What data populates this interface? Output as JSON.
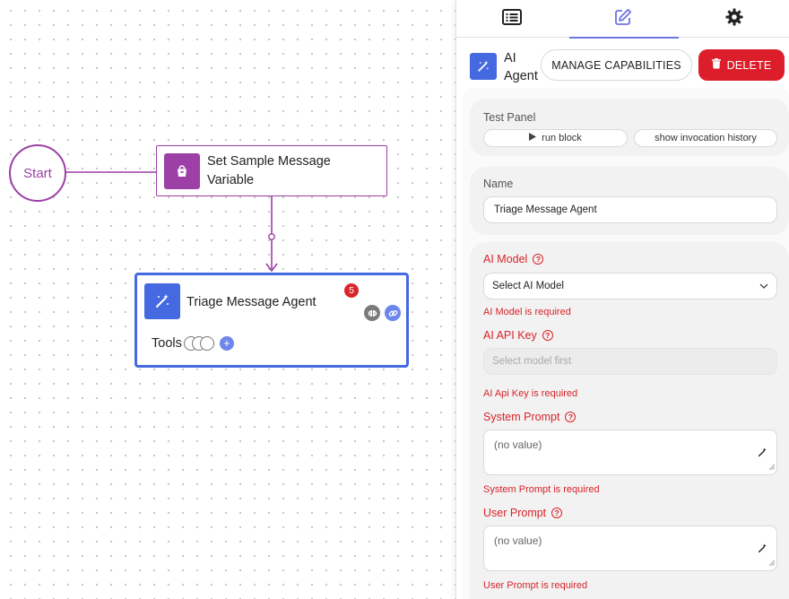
{
  "canvas": {
    "start_label": "Start",
    "set_node": {
      "label": "Set Sample Message Variable",
      "color": "#9c3fa6",
      "icon": "shopping-bag-icon"
    },
    "agent_node": {
      "label": "Triage Message Agent",
      "badge_count": "5",
      "tools_label": "Tools",
      "add_tool": "+",
      "color": "#4569e0",
      "icons": [
        "magic-wand-icon",
        "brain-icon",
        "link-icon"
      ]
    }
  },
  "panel": {
    "tabs": [
      {
        "icon": "list-icon"
      },
      {
        "icon": "edit-icon",
        "active": true
      },
      {
        "icon": "gear-icon"
      }
    ],
    "header": {
      "title": "AI Agent",
      "manage_label": "MANAGE CAPABILITIES",
      "delete_label": "DELETE",
      "delete_color": "#dc1e2a"
    },
    "test_panel": {
      "title": "Test Panel",
      "run_label": "run block",
      "history_label": "show invocation history"
    },
    "name": {
      "label": "Name",
      "value": "Triage Message Agent"
    },
    "fields": {
      "ai_model": {
        "label": "AI Model",
        "help": "?",
        "value": "Select AI Model",
        "error": "AI Model is required"
      },
      "api_key": {
        "label": "AI API Key",
        "help": "?",
        "placeholder": "Select model first",
        "error": "AI Api Key is required"
      },
      "system_prompt": {
        "label": "System Prompt",
        "help": "?",
        "value": "(no value)",
        "error": "System Prompt is required"
      },
      "user_prompt": {
        "label": "User Prompt",
        "help": "?",
        "value": "(no value)",
        "error": "User Prompt is required"
      }
    },
    "error_color": "#d8232a"
  }
}
